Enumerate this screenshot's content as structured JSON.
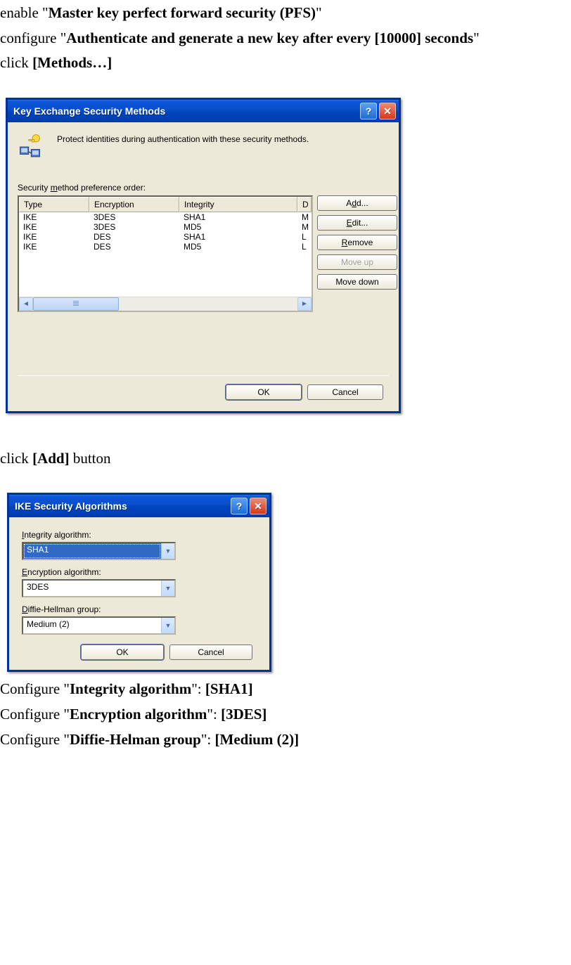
{
  "instructions": {
    "line1_pre": "enable \"",
    "line1_bold": "Master key perfect forward security (PFS)",
    "line1_post": "\"",
    "line2_pre": "configure \"",
    "line2_bold": "Authenticate and generate a new key after every [10000] seconds",
    "line2_post": "\"",
    "line3_pre": "click ",
    "line3_bold": "[Methods…]",
    "click_add_pre": "click ",
    "click_add_bold": "[Add]",
    "click_add_post": " button",
    "cfg_int_pre": "Configure \"",
    "cfg_int_bold1": "Integrity algorithm",
    "cfg_int_mid": "\": ",
    "cfg_int_bold2": "[SHA1]",
    "cfg_enc_pre": "Configure \"",
    "cfg_enc_bold1": "Encryption algorithm",
    "cfg_enc_mid": "\": ",
    "cfg_enc_bold2": "[3DES]",
    "cfg_dh_pre": "Configure \"",
    "cfg_dh_bold1": "Diffie-Helman group",
    "cfg_dh_mid": "\": ",
    "cfg_dh_bold2": "[Medium (2)]"
  },
  "dialog1": {
    "title": "Key Exchange Security Methods",
    "desc": "Protect identities during authentication with these security methods.",
    "pref_label_pre": "Security ",
    "pref_label_ul": "m",
    "pref_label_post": "ethod preference order:",
    "columns": {
      "type": "Type",
      "encryption": "Encryption",
      "integrity": "Integrity",
      "d": "D"
    },
    "rows": [
      {
        "type": "IKE",
        "encryption": "3DES",
        "integrity": "SHA1",
        "d": "M"
      },
      {
        "type": "IKE",
        "encryption": "3DES",
        "integrity": "MD5",
        "d": "M"
      },
      {
        "type": "IKE",
        "encryption": "DES",
        "integrity": "SHA1",
        "d": "L"
      },
      {
        "type": "IKE",
        "encryption": "DES",
        "integrity": "MD5",
        "d": "L"
      }
    ],
    "buttons": {
      "add_pre": "A",
      "add_ul": "d",
      "add_post": "d...",
      "edit_ul": "E",
      "edit_post": "dit...",
      "remove_ul": "R",
      "remove_post": "emove",
      "moveup": "Move up",
      "movedown": "Move down",
      "ok": "OK",
      "cancel": "Cancel"
    }
  },
  "dialog2": {
    "title": "IKE Security Algorithms",
    "integrity_label_ul": "I",
    "integrity_label_post": "ntegrity algorithm:",
    "integrity_value": "SHA1",
    "encryption_label_ul": "E",
    "encryption_label_post": "ncryption algorithm:",
    "encryption_value": "3DES",
    "dh_label_ul": "D",
    "dh_label_post": "iffie-Hellman group:",
    "dh_value": "Medium (2)",
    "ok": "OK",
    "cancel": "Cancel"
  }
}
